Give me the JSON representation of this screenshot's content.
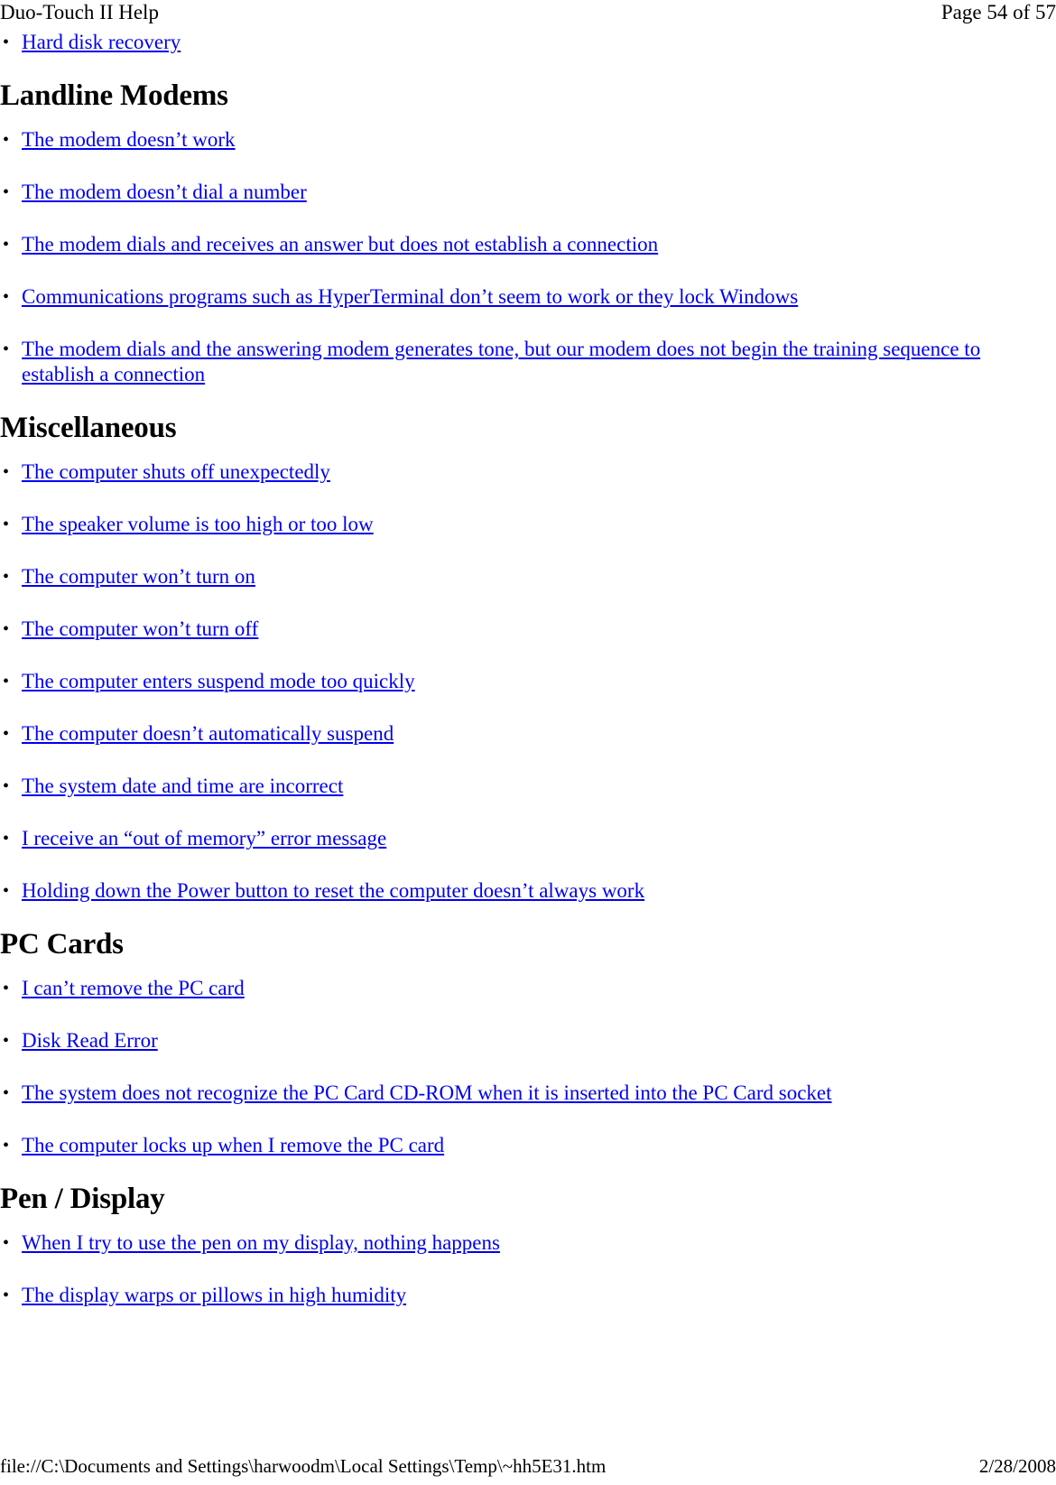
{
  "header": {
    "title": "Duo-Touch II Help",
    "page_indicator": "Page 54 of 57"
  },
  "intro_list": [
    {
      "label": "Hard disk recovery"
    }
  ],
  "sections": [
    {
      "heading": "Landline Modems",
      "links": [
        {
          "label": "The modem doesn’t work"
        },
        {
          "label": "The modem doesn’t dial a number"
        },
        {
          "label": "The modem dials and receives an answer but does not establish a connection"
        },
        {
          "label": "Communications programs such as HyperTerminal don’t seem to work or they lock Windows"
        },
        {
          "label": "The modem dials and the answering modem generates tone, but our modem does not begin the training sequence to establish a connection"
        }
      ]
    },
    {
      "heading": "Miscellaneous",
      "links": [
        {
          "label": "The computer shuts off unexpectedly"
        },
        {
          "label": "The speaker volume is too high or too low"
        },
        {
          "label": "The computer won’t turn on"
        },
        {
          "label": "The computer won’t turn off"
        },
        {
          "label": "The computer enters suspend mode too quickly"
        },
        {
          "label": "The computer doesn’t automatically suspend"
        },
        {
          "label": "The system date and time are incorrect"
        },
        {
          "label": "I receive an “out of memory” error message"
        },
        {
          "label": "Holding down the Power button to reset the computer doesn’t always work"
        }
      ]
    },
    {
      "heading": "PC Cards",
      "links": [
        {
          "label": "I can’t remove the PC card"
        },
        {
          "label": "Disk Read Error"
        },
        {
          "label": "The system does not recognize the PC Card CD-ROM when it is inserted into the PC Card socket"
        },
        {
          "label": "The computer locks up when I remove the PC card"
        }
      ]
    },
    {
      "heading": "Pen / Display",
      "links": [
        {
          "label": "When I try to use the pen on my display, nothing happens"
        },
        {
          "label": "The display warps or pillows in high humidity"
        }
      ]
    }
  ],
  "footer": {
    "file_path": "file://C:\\Documents and Settings\\harwoodm\\Local Settings\\Temp\\~hh5E31.htm",
    "date": "2/28/2008"
  },
  "colors": {
    "link": "#0000ee",
    "text": "#000000",
    "background": "#ffffff"
  }
}
